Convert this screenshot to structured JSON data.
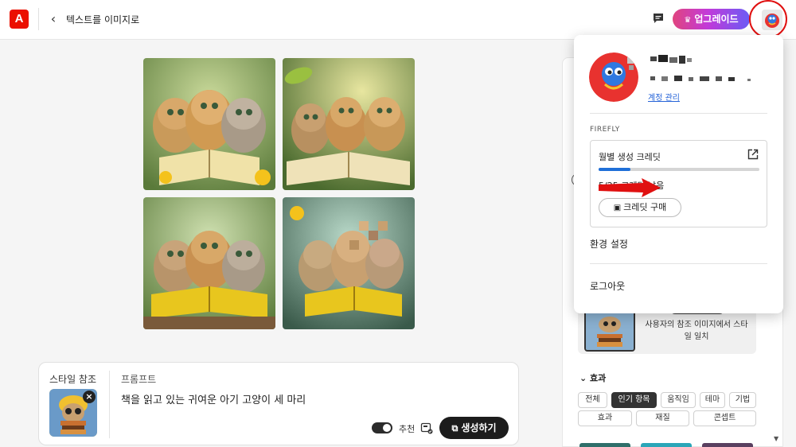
{
  "header": {
    "logo_text": "A",
    "back_symbol": "‹",
    "page_title": "텍스트를 이미지로",
    "upgrade_label": "업그레이드",
    "colors": {
      "logo": "#eb1000",
      "annotation": "#e01010"
    }
  },
  "gallery": {
    "images": [
      {
        "alt": "책 읽는 아기 고양이 세 마리 1"
      },
      {
        "alt": "책 읽는 아기 고양이 세 마리 2"
      },
      {
        "alt": "책 읽는 아기 고양이 세 마리 3"
      },
      {
        "alt": "책 읽는 아기 고양이 세 마리 4"
      }
    ]
  },
  "prompt_box": {
    "style_ref_label": "스타일 참조",
    "prompt_label": "프롬프트",
    "prompt_text": "책을 읽고 있는 귀여운 아기 고양이 세 마리",
    "recommend_label": "추천",
    "generate_label": "생성하기"
  },
  "right_panel": {
    "style_match_text": "사용자의 참조 이미지에서 스타일 일치",
    "effects_title": "효과",
    "effect_chips": [
      "전체",
      "인기 항목",
      "움직임",
      "테마",
      "기법",
      "효과",
      "재질",
      "콘셉트"
    ],
    "active_chip": "인기 항목"
  },
  "account_menu": {
    "manage_account": "계정 관리",
    "section_label": "FIREFLY",
    "credits_title": "월별 생성 크레딧",
    "credits_used": 5,
    "credits_total": 25,
    "credits_remaining_text": "5/25 크레딧 남음",
    "buy_credits_label": "크레딧 구매",
    "preferences_label": "환경 설정",
    "logout_label": "로그아웃",
    "colors": {
      "progress": "#1f6fd8"
    }
  }
}
